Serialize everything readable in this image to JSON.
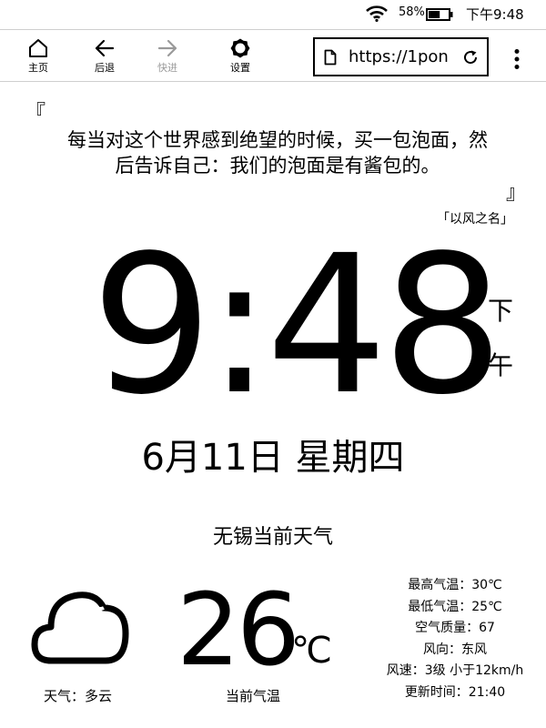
{
  "status": {
    "battery_percent": "58%",
    "battery_level": 0.58,
    "time": "下午9:48",
    "icons": [
      "wifi-icon",
      "battery-icon"
    ]
  },
  "toolbar": {
    "home_label": "主页",
    "back_label": "后退",
    "forward_label": "快进",
    "settings_label": "设置",
    "url": "https://1pon",
    "icons": [
      "home-icon",
      "arrow-left-icon",
      "arrow-right-icon",
      "gear-icon",
      "document-icon",
      "reload-icon",
      "more-vertical-icon"
    ]
  },
  "quote": {
    "open_mark": "『",
    "text": "每当对这个世界感到绝望的时候，买一包泡面，然后告诉自己：我们的泡面是有酱包的。",
    "close_mark": "』",
    "source": "「以风之名」"
  },
  "clock": {
    "time": "9:48",
    "ampm_1": "下",
    "ampm_2": "午",
    "date": "6月11日 星期四"
  },
  "weather": {
    "title": "无锡当前天气",
    "condition": "天气：多云",
    "condition_icon": "cloud-icon",
    "temperature": "26",
    "unit": "℃",
    "temperature_label": "当前气温",
    "details": [
      "最高气温：30℃",
      "最低气温：25℃",
      "空气质量：67",
      "风向：东风",
      "风速：3级 小于12km/h",
      "更新时间：21:40"
    ]
  },
  "colors": {
    "foreground": "#000000",
    "background": "#ffffff",
    "disabled": "#9a9a9a",
    "divider": "#cfcfcf"
  }
}
